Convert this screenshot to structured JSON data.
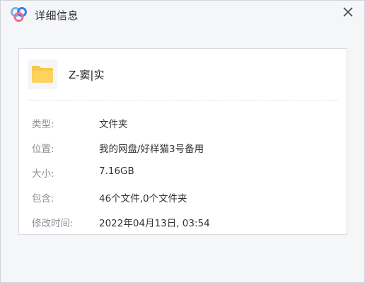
{
  "window": {
    "title": "详细信息",
    "icons": {
      "app": "baidu-netdisk-logo-icon",
      "close": "close-icon"
    }
  },
  "file": {
    "name": "Z-窦|实",
    "icon": "folder-icon",
    "folder_color": "#f7c84b"
  },
  "details": [
    {
      "label": "类型:",
      "value": "文件夹"
    },
    {
      "label": "位置:",
      "value": "我的网盘/好样猫3号备用"
    },
    {
      "label": "大小:",
      "value": "7.16GB"
    },
    {
      "label": "包含:",
      "value": "46个文件,0个文件夹"
    },
    {
      "label": "修改时间:",
      "value": "2022年04月13日, 03:54"
    }
  ],
  "colors": {
    "logo_blue": "#3b7fe8",
    "logo_light": "#70b5f5",
    "logo_pink": "#f26a8d"
  }
}
